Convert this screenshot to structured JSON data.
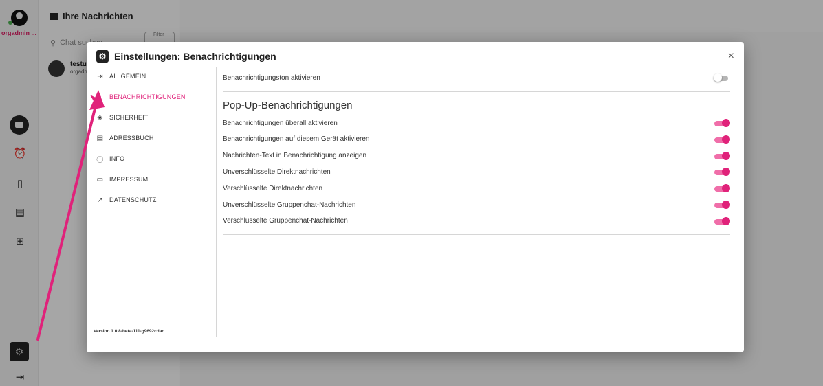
{
  "app": {
    "username": "orgadmin ...",
    "inbox_title": "Ihre Nachrichten",
    "search_placeholder": "Chat suchen",
    "filter_label": "Filter",
    "chat_item": {
      "name": "testus",
      "sub": "orgadm"
    }
  },
  "dialog": {
    "title": "Einstellungen: Benachrichtigungen",
    "close": "×",
    "version": "Version 1.0.8-beta-111-g9692cdac",
    "nav": [
      {
        "label": "ALLGEMEIN",
        "icon": "login-icon",
        "glyph": "⇥",
        "active": false
      },
      {
        "label": "BENACHRICHTIGUNGEN",
        "icon": "bell-plus-icon",
        "glyph": "♪",
        "active": true
      },
      {
        "label": "SICHERHEIT",
        "icon": "shield-icon",
        "glyph": "◈",
        "active": false
      },
      {
        "label": "ADRESSBUCH",
        "icon": "contacts-icon",
        "glyph": "▤",
        "active": false
      },
      {
        "label": "INFO",
        "icon": "info-icon",
        "glyph": "ⓘ",
        "active": false
      },
      {
        "label": "IMPRESSUM",
        "icon": "document-icon",
        "glyph": "▭",
        "active": false
      },
      {
        "label": "DATENSCHUTZ",
        "icon": "open-in-new-icon",
        "glyph": "↗",
        "active": false
      }
    ],
    "sound_toggle": {
      "label": "Benachrichtigungston aktivieren",
      "on": false
    },
    "section_title": "Pop-Up-Benachrichtigungen",
    "toggles": [
      {
        "label": "Benachrichtigungen überall aktivieren",
        "on": true
      },
      {
        "label": "Benachrichtigungen auf diesem Gerät aktivieren",
        "on": true
      },
      {
        "label": "Nachrichten-Text in Benachrichtigung anzeigen",
        "on": true
      },
      {
        "label": "Unverschlüsselte Direktnachrichten",
        "on": true
      },
      {
        "label": "Verschlüsselte Direktnachrichten",
        "on": true
      },
      {
        "label": "Unverschlüsselte Gruppenchat-Nachrichten",
        "on": true
      },
      {
        "label": "Verschlüsselte Gruppenchat-Nachrichten",
        "on": true
      }
    ]
  },
  "colors": {
    "accent": "#e0227a",
    "accent_track": "#f06ea9",
    "annotation_arrow": "#e0227a"
  }
}
